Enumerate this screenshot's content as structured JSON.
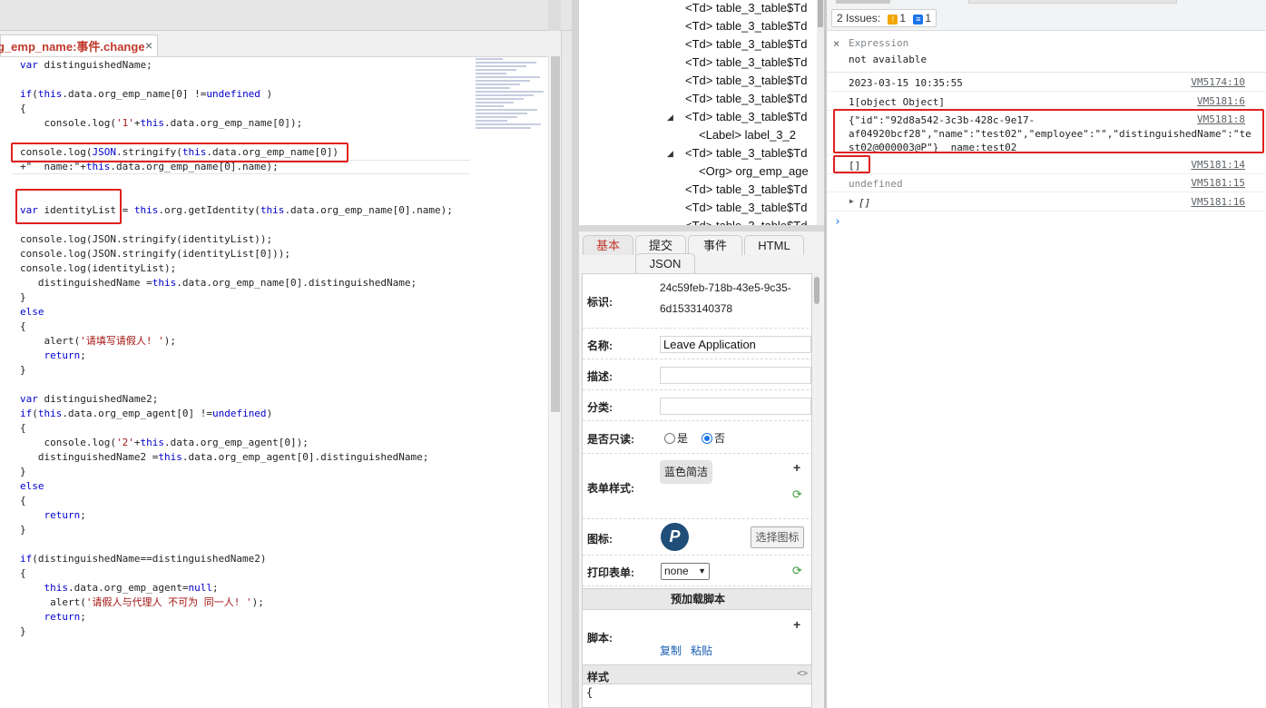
{
  "editor": {
    "tab_title": "g_emp_name:事件.change",
    "tab_close": "×",
    "code_lines": [
      [
        {
          "t": "var",
          "c": "kw"
        },
        {
          "t": " distinguishedName;"
        }
      ],
      [],
      [
        {
          "t": "if",
          "c": "kw"
        },
        {
          "t": "("
        },
        {
          "t": "this",
          "c": "kw"
        },
        {
          "t": ".data.org_emp_name[0] !="
        },
        {
          "t": "undefined",
          "c": "kw"
        },
        {
          "t": " )"
        }
      ],
      [
        {
          "t": "{"
        }
      ],
      [
        {
          "t": "    console.log("
        },
        {
          "t": "'1'",
          "c": "str"
        },
        {
          "t": "+"
        },
        {
          "t": "this",
          "c": "kw"
        },
        {
          "t": ".data.org_emp_name[0]);"
        }
      ],
      [],
      [
        {
          "t": "console.log("
        },
        {
          "t": "JSON",
          "c": "kw"
        },
        {
          "t": ".stringify("
        },
        {
          "t": "this",
          "c": "kw"
        },
        {
          "t": ".data.org_emp_name[0])"
        }
      ],
      [
        {
          "t": "+\"  name:\"+"
        },
        {
          "t": "this",
          "c": "kw"
        },
        {
          "t": ".data.org_emp_name[0].name);"
        }
      ],
      [],
      [],
      [
        {
          "t": "var",
          "c": "kw"
        },
        {
          "t": " identityList = "
        },
        {
          "t": "this",
          "c": "kw"
        },
        {
          "t": ".org.getIdentity("
        },
        {
          "t": "this",
          "c": "kw"
        },
        {
          "t": ".data.org_emp_name[0].name);"
        }
      ],
      [],
      [
        {
          "t": "console.log(JSON.stringify(identityList));"
        }
      ],
      [
        {
          "t": "console.log(JSON.stringify(identityList[0]));"
        }
      ],
      [
        {
          "t": "console.log(identityList);"
        }
      ],
      [
        {
          "t": "   distinguishedName ="
        },
        {
          "t": "this",
          "c": "kw"
        },
        {
          "t": ".data.org_emp_name[0].distinguishedName;"
        }
      ],
      [
        {
          "t": "}"
        }
      ],
      [
        {
          "t": "else",
          "c": "kw"
        }
      ],
      [
        {
          "t": "{"
        }
      ],
      [
        {
          "t": "    alert("
        },
        {
          "t": "'请填写请假人! '",
          "c": "str"
        },
        {
          "t": ");"
        }
      ],
      [
        {
          "t": "    "
        },
        {
          "t": "return",
          "c": "kw"
        },
        {
          "t": ";"
        }
      ],
      [
        {
          "t": "}"
        }
      ],
      [],
      [
        {
          "t": "var",
          "c": "kw"
        },
        {
          "t": " distinguishedName2;"
        }
      ],
      [
        {
          "t": "if",
          "c": "kw"
        },
        {
          "t": "("
        },
        {
          "t": "this",
          "c": "kw"
        },
        {
          "t": ".data.org_emp_agent[0] !="
        },
        {
          "t": "undefined",
          "c": "kw"
        },
        {
          "t": ")"
        }
      ],
      [
        {
          "t": "{"
        }
      ],
      [
        {
          "t": "    console.log("
        },
        {
          "t": "'2'",
          "c": "str"
        },
        {
          "t": "+"
        },
        {
          "t": "this",
          "c": "kw"
        },
        {
          "t": ".data.org_emp_agent[0]);"
        }
      ],
      [
        {
          "t": "   distinguishedName2 ="
        },
        {
          "t": "this",
          "c": "kw"
        },
        {
          "t": ".data.org_emp_agent[0].distinguishedName;"
        }
      ],
      [
        {
          "t": "}"
        }
      ],
      [
        {
          "t": "else",
          "c": "kw"
        }
      ],
      [
        {
          "t": "{"
        }
      ],
      [
        {
          "t": "    "
        },
        {
          "t": "return",
          "c": "kw"
        },
        {
          "t": ";"
        }
      ],
      [
        {
          "t": "}"
        }
      ],
      [],
      [
        {
          "t": "if",
          "c": "kw"
        },
        {
          "t": "(distinguishedName==distinguishedName2)"
        }
      ],
      [
        {
          "t": "{"
        }
      ],
      [
        {
          "t": "    "
        },
        {
          "t": "this",
          "c": "kw"
        },
        {
          "t": ".data.org_emp_agent="
        },
        {
          "t": "null",
          "c": "kw"
        },
        {
          "t": ";"
        }
      ],
      [
        {
          "t": "     alert("
        },
        {
          "t": "'请假人与代理人 不可为 同一人! '",
          "c": "str"
        },
        {
          "t": ");"
        }
      ],
      [
        {
          "t": "    "
        },
        {
          "t": "return",
          "c": "kw"
        },
        {
          "t": ";"
        }
      ],
      [
        {
          "t": "}"
        }
      ]
    ]
  },
  "dom_tree": {
    "nodes": [
      {
        "text": "<Td> table_3_table$Td",
        "tri": ""
      },
      {
        "text": "<Td> table_3_table$Td",
        "tri": ""
      },
      {
        "text": "<Td> table_3_table$Td",
        "tri": ""
      },
      {
        "text": "<Td> table_3_table$Td",
        "tri": ""
      },
      {
        "text": "<Td> table_3_table$Td",
        "tri": ""
      },
      {
        "text": "<Td> table_3_table$Td",
        "tri": ""
      },
      {
        "text": "<Td> table_3_table$Td",
        "tri": "◢"
      },
      {
        "text": "<Label> label_3_2",
        "tri": ""
      },
      {
        "text": "<Td> table_3_table$Td",
        "tri": "◢"
      },
      {
        "text": "<Org> org_emp_age",
        "tri": ""
      },
      {
        "text": "<Td> table_3_table$Td",
        "tri": ""
      },
      {
        "text": "<Td> table_3_table$Td",
        "tri": ""
      },
      {
        "text": "<Td> table_3_table$Td",
        "tri": ""
      }
    ]
  },
  "props": {
    "tabs": [
      "基本",
      "提交",
      "事件",
      "HTML",
      "JSON"
    ],
    "id_label": "标识:",
    "id_value_line1": "24c59feb-718b-43e5-9c35-",
    "id_value_line2": "6d1533140378",
    "name_label": "名称:",
    "name_value": "Leave Application",
    "desc_label": "描述:",
    "category_label": "分类:",
    "readonly_label": "是否只读:",
    "readonly_yes": "是",
    "readonly_no": "否",
    "style_label": "表单样式:",
    "style_value": "蓝色简洁",
    "plus_glyph": "+",
    "refresh_glyph": "⟳",
    "icon_label": "图标:",
    "icon_letter": "P",
    "choose_icon_btn": "选择图标",
    "print_label": "打印表单:",
    "print_value": "none",
    "preload_header": "预加载脚本",
    "script_label": "脚本:",
    "copy_link": "复制",
    "paste_link": "粘贴",
    "css_header": "样式",
    "css_toggle": "<>",
    "css_first_line": "{"
  },
  "console": {
    "issues_label": "2 Issues:",
    "issues_warn_count": "1",
    "issues_info_count": "1",
    "expression_label": "Expression",
    "expression_value": "not available",
    "close_glyph": "×",
    "messages": [
      {
        "text": "2023-03-15 10:35:55",
        "src": "VM5174:10"
      },
      {
        "text": "1[object Object]",
        "src": "VM5181:6"
      },
      {
        "text": "{\"id\":\"92d8a542-3c3b-428c-9e17-\naf04920bcf28\",\"name\":\"test02\",\"employee\":\"\",\"distinguishedName\":\"te\nst02@000003@P\"}  name:test02",
        "src": "VM5181:8"
      },
      {
        "text": "[]",
        "src": "VM5181:14"
      },
      {
        "text": "undefined",
        "src": "VM5181:15"
      },
      {
        "text": "[]",
        "src": "VM5181:16"
      }
    ],
    "expand_glyph": "▶",
    "prompt_glyph": "›"
  },
  "colors": {
    "highlight_box": "#e02020",
    "keyword": "#0000cc",
    "string": "#a31515",
    "active_tab": "#c0392b",
    "link": "#1a5fb4",
    "icon_bg": "#1f4e79"
  }
}
